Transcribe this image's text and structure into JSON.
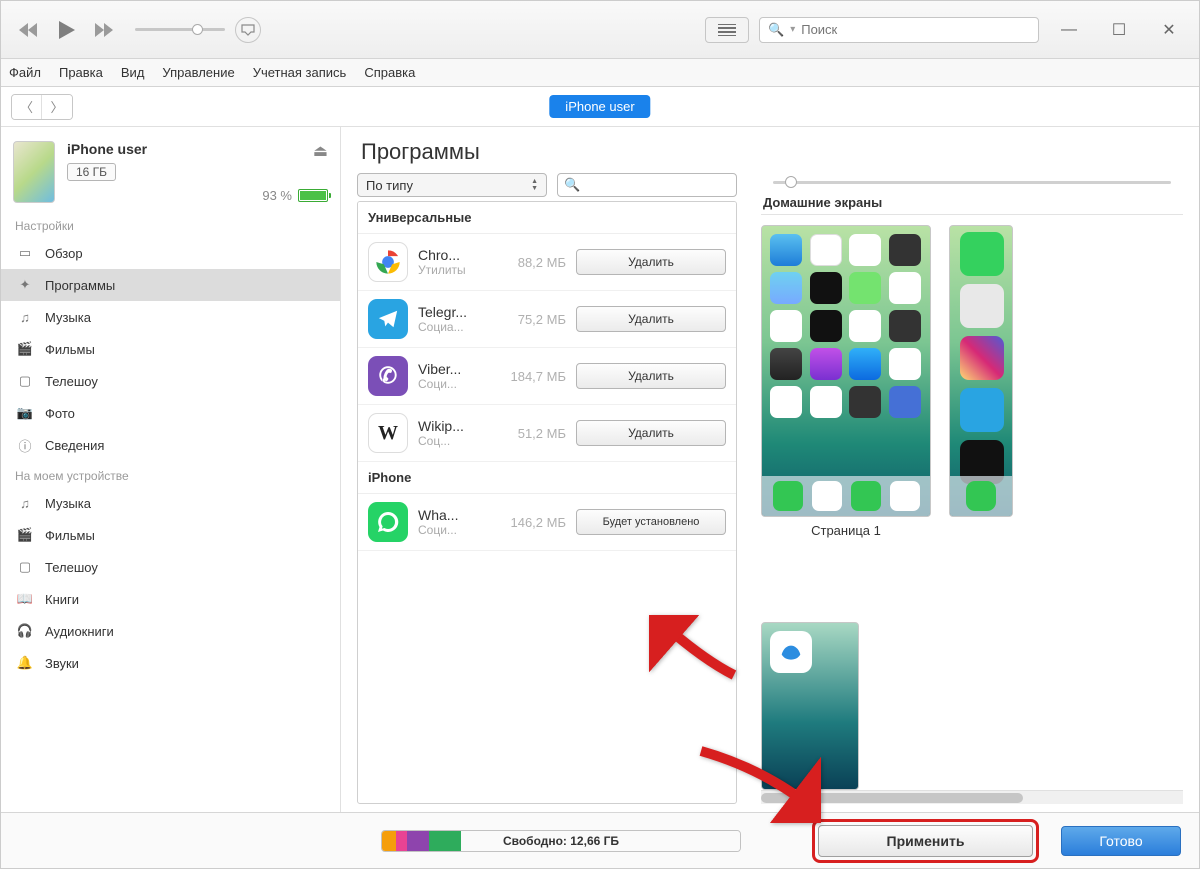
{
  "titlebar": {
    "search_placeholder": "Поиск"
  },
  "menubar": [
    "Файл",
    "Правка",
    "Вид",
    "Управление",
    "Учетная запись",
    "Справка"
  ],
  "navrow": {
    "device_pill": "iPhone user"
  },
  "sidebar": {
    "device": {
      "name": "iPhone user",
      "storage": "16 ГБ",
      "battery_pct": "93 %"
    },
    "section_settings": "Настройки",
    "settings_items": [
      {
        "icon": "overview-icon",
        "label": "Обзор"
      },
      {
        "icon": "apps-icon",
        "label": "Программы",
        "selected": true
      },
      {
        "icon": "music-icon",
        "label": "Музыка"
      },
      {
        "icon": "movies-icon",
        "label": "Фильмы"
      },
      {
        "icon": "tv-icon",
        "label": "Телешоу"
      },
      {
        "icon": "photo-icon",
        "label": "Фото"
      },
      {
        "icon": "info-icon",
        "label": "Сведения"
      }
    ],
    "section_device": "На моем устройстве",
    "device_items": [
      {
        "icon": "music-icon",
        "label": "Музыка"
      },
      {
        "icon": "movies-icon",
        "label": "Фильмы"
      },
      {
        "icon": "tv-icon",
        "label": "Телешоу"
      },
      {
        "icon": "books-icon",
        "label": "Книги"
      },
      {
        "icon": "audiobooks-icon",
        "label": "Аудиокниги"
      },
      {
        "icon": "tones-icon",
        "label": "Звуки"
      }
    ]
  },
  "content": {
    "header": "Программы",
    "sort_label": "По типу",
    "section_universal": "Универсальные",
    "section_iphone": "iPhone",
    "apps_universal": [
      {
        "name": "Chro...",
        "cat": "Утилиты",
        "size": "88,2 МБ",
        "btn": "Удалить",
        "bg": "#ffffff",
        "letter": ""
      },
      {
        "name": "Telegr...",
        "cat": "Социа...",
        "size": "75,2 МБ",
        "btn": "Удалить",
        "bg": "#29a4e2",
        "letter": ""
      },
      {
        "name": "Viber...",
        "cat": "Соци...",
        "size": "184,7 МБ",
        "btn": "Удалить",
        "bg": "#7b4fb7",
        "letter": ""
      },
      {
        "name": "Wikip...",
        "cat": "Соц...",
        "size": "51,2 МБ",
        "btn": "Удалить",
        "bg": "#ffffff",
        "letter": "W"
      }
    ],
    "apps_iphone": [
      {
        "name": "Wha...",
        "cat": "Соци...",
        "size": "146,2 МБ",
        "btn": "Будет установлено",
        "bg": "#25d366",
        "install": true
      }
    ],
    "screens_title": "Домашние экраны",
    "page1_label": "Страница 1"
  },
  "bottom": {
    "free_label": "Свободно: 12,66 ГБ",
    "apply": "Применить",
    "done": "Готово"
  }
}
